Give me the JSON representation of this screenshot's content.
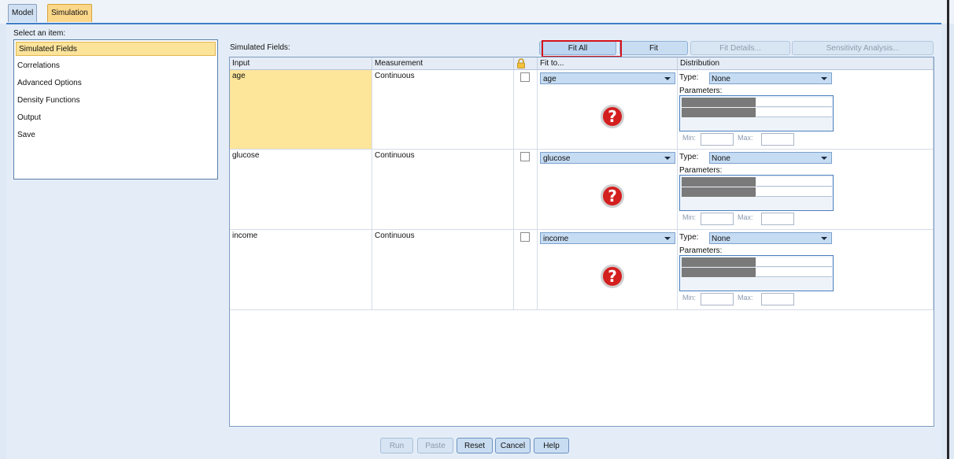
{
  "tabs": [
    {
      "label": "Model",
      "active": false
    },
    {
      "label": "Simulation",
      "active": true
    }
  ],
  "nav": {
    "heading": "Select an item:",
    "items": [
      {
        "label": "Simulated Fields",
        "selected": true
      },
      {
        "label": "Correlations"
      },
      {
        "label": "Advanced Options"
      },
      {
        "label": "Density Functions"
      },
      {
        "label": "Output"
      },
      {
        "label": "Save"
      }
    ]
  },
  "main": {
    "heading": "Simulated Fields:",
    "buttons": {
      "fit_all": "Fit All",
      "fit": "Fit",
      "fit_details": "Fit Details...",
      "sensitivity": "Sensitivity Analysis..."
    },
    "columns": [
      "Input",
      "Measurement",
      "lock-icon",
      "Fit to...",
      "Distribution"
    ],
    "rows": [
      {
        "input": "age",
        "measurement": "Continuous",
        "fit_to": "age",
        "type": "None"
      },
      {
        "input": "glucose",
        "measurement": "Continuous",
        "fit_to": "glucose",
        "type": "None"
      },
      {
        "input": "income",
        "measurement": "Continuous",
        "fit_to": "income",
        "type": "None"
      }
    ],
    "labels": {
      "type": "Type:",
      "parameters": "Parameters:",
      "min": "Min:",
      "max": "Max:"
    },
    "help_glyph": "?"
  },
  "footer": {
    "run": "Run",
    "paste": "Paste",
    "reset": "Reset",
    "cancel": "Cancel",
    "help": "Help"
  },
  "colors": {
    "selection": "#fde59a",
    "highlight_box": "#d4121b",
    "accent": "#3f7fc7"
  }
}
